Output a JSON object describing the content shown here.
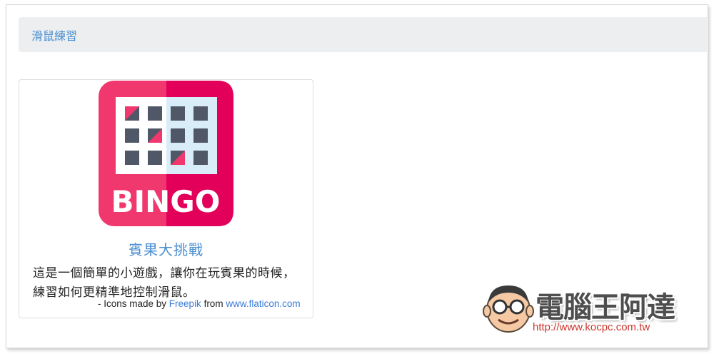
{
  "section": {
    "title": "滑鼠練習"
  },
  "card": {
    "icon": "bingo-icon",
    "icon_text": "BINGO",
    "title": "賓果大挑戰",
    "description": "這是一個簡單的小遊戲，讓你在玩賓果的時候，練習如何更精準地控制滑鼠。",
    "credit_prefix": "- Icons made by ",
    "credit_author": "Freepik",
    "credit_middle": " from ",
    "credit_site": "www.flaticon.com"
  },
  "watermark": {
    "name": "電腦王阿達",
    "url": "http://www.kocpc.com.tw"
  },
  "colors": {
    "link": "#4b8fcf",
    "header_bg": "#eceef0",
    "bingo_pink": "#f0376e",
    "bingo_magenta": "#e2005b"
  }
}
